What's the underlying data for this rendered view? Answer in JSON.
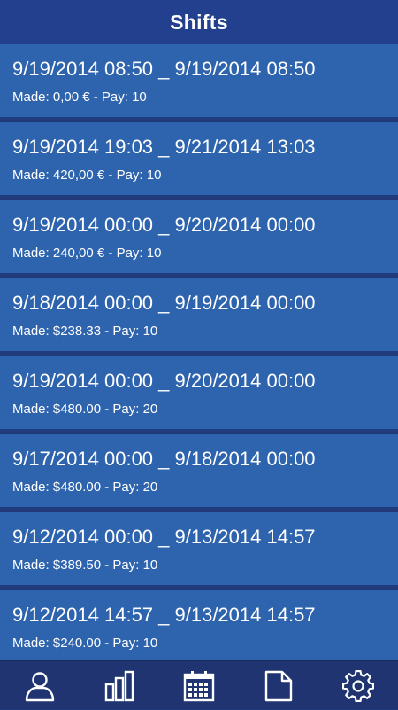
{
  "header": {
    "title": "Shifts"
  },
  "shifts": [
    {
      "range": "9/19/2014 08:50 _ 9/19/2014 08:50",
      "details": "Made: 0,00 € - Pay: 10"
    },
    {
      "range": "9/19/2014 19:03 _ 9/21/2014 13:03",
      "details": "Made: 420,00 € - Pay: 10"
    },
    {
      "range": "9/19/2014 00:00 _ 9/20/2014 00:00",
      "details": "Made: 240,00 € - Pay: 10"
    },
    {
      "range": "9/18/2014 00:00 _ 9/19/2014 00:00",
      "details": "Made: $238.33 - Pay: 10"
    },
    {
      "range": "9/19/2014 00:00 _ 9/20/2014 00:00",
      "details": "Made: $480.00 - Pay: 20"
    },
    {
      "range": "9/17/2014 00:00 _ 9/18/2014 00:00",
      "details": "Made: $480.00 - Pay: 20"
    },
    {
      "range": "9/12/2014 00:00 _ 9/13/2014 14:57",
      "details": "Made: $389.50 - Pay: 10"
    },
    {
      "range": "9/12/2014 14:57 _ 9/13/2014 14:57",
      "details": "Made: $240.00 - Pay: 10"
    }
  ],
  "tabbar": {
    "tabs": [
      {
        "icon": "person-icon"
      },
      {
        "icon": "bar-chart-icon"
      },
      {
        "icon": "calendar-icon"
      },
      {
        "icon": "document-icon"
      },
      {
        "icon": "gear-icon"
      }
    ]
  },
  "colors": {
    "header": "#23408e",
    "item": "#2e63ad",
    "divider": "#203c7c",
    "tabbar": "#1f3470",
    "text": "#ffffff"
  }
}
